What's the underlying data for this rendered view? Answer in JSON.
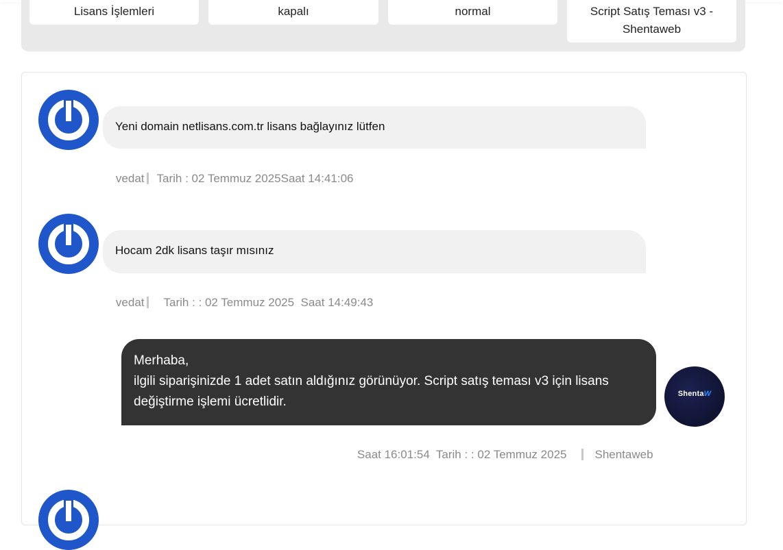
{
  "info_cards": [
    {
      "text": "Lisans İşlemleri"
    },
    {
      "text": "kapalı"
    },
    {
      "text": "normal"
    },
    {
      "text": "Script Satış Teması v3 - Shentaweb"
    }
  ],
  "messages": [
    {
      "sender": "vedat",
      "text": "Yeni domain netlisans.com.tr lisans bağlayınız lütfen",
      "meta": "Tarih : 02 Temmuz 2025Saat 14:41:06"
    },
    {
      "sender": "vedat",
      "text": "Hocam 2dk lisans taşır mısınız",
      "meta": "Tarih : : 02 Temmuz 2025  Saat 14:49:43"
    },
    {
      "sender": "Shentaweb",
      "text_lines": [
        "Merhaba,",
        "ilgili siparişinizde 1 adet satın aldığınız görünüyor. Script satış teması v3 için lisans",
        "değiştirme işlemi ücretlidir."
      ],
      "meta": "Saat 16:01:54  Tarih : : 02 Temmuz 2025",
      "avatar_logo_text": "Shenta",
      "avatar_logo_mark": "W"
    }
  ],
  "colors": {
    "user_avatar": "#1f56c9",
    "user_bubble": "#f1f1f1",
    "admin_bubble": "#333333",
    "meta_text": "#8a8a8a",
    "panel_bg": "#e9e9e9"
  }
}
